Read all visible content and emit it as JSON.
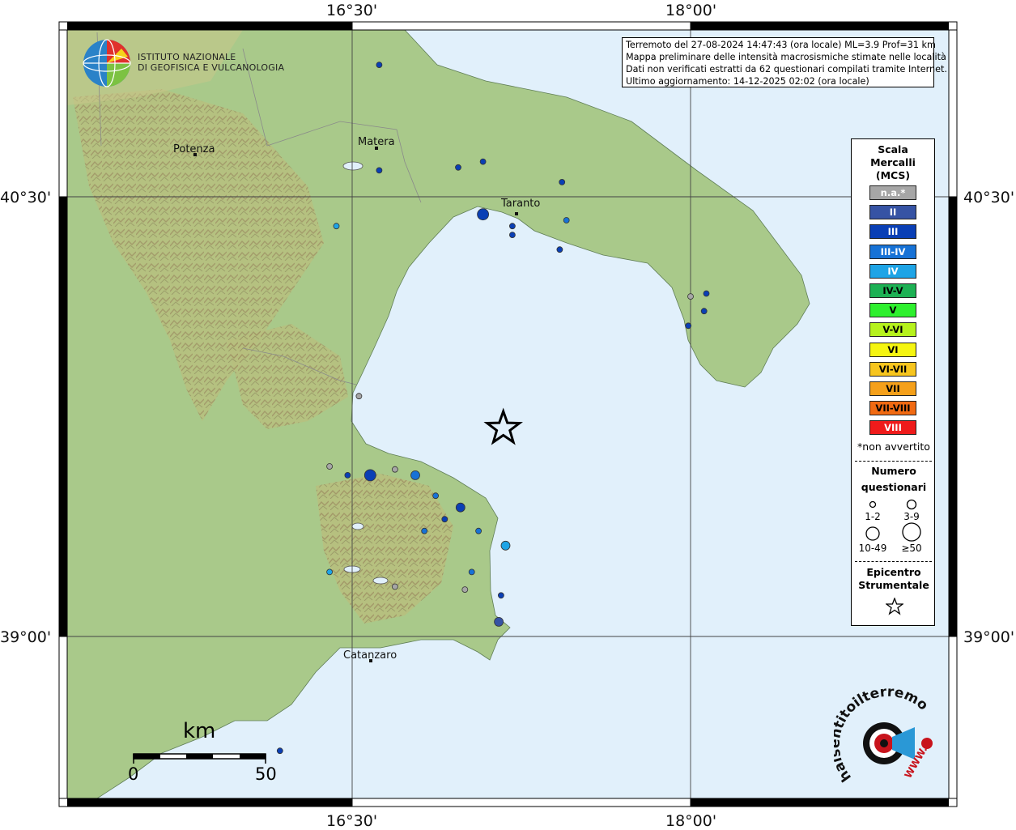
{
  "map_title": {
    "lines": [
      "Terremoto del 27-08-2024 14:47:43 (ora locale) ML=3.9 Prof=31 km",
      "Mappa preliminare delle intensità macrosismiche stimate nelle località",
      "Dati non verificati estratti da 62 questionari compilati tramite Internet.",
      "Ultimo aggiornamento: 14-12-2025 02:02 (ora locale)"
    ]
  },
  "institute": {
    "line1": "ISTITUTO NAZIONALE",
    "line2": "DI GEOFISICA E VULCANOLOGIA"
  },
  "grid_labels": {
    "lon_left": "16°30'",
    "lon_right": "18°00'",
    "lat_top": "40°30'",
    "lat_bottom": "39°00'"
  },
  "cities": {
    "potenza": "Potenza",
    "matera": "Matera",
    "taranto": "Taranto",
    "catanzaro": "Catanzaro"
  },
  "legend": {
    "title": [
      "Scala",
      "Mercalli",
      "(MCS)"
    ],
    "classes": [
      {
        "label": "n.a.*",
        "color": "#a6a6a6",
        "text_color": "#ffffff"
      },
      {
        "label": "II",
        "color": "#3653a4",
        "text_color": "#ffffff"
      },
      {
        "label": "III",
        "color": "#0a3fb5",
        "text_color": "#ffffff"
      },
      {
        "label": "III-IV",
        "color": "#1772d6",
        "text_color": "#ffffff"
      },
      {
        "label": "IV",
        "color": "#1ea4e6",
        "text_color": "#ffffff"
      },
      {
        "label": "IV-V",
        "color": "#1db154",
        "text_color": "#000000"
      },
      {
        "label": "V",
        "color": "#2ef02e",
        "text_color": "#000000"
      },
      {
        "label": "V-VI",
        "color": "#b6f21d",
        "text_color": "#000000"
      },
      {
        "label": "VI",
        "color": "#f5f511",
        "text_color": "#000000"
      },
      {
        "label": "VI-VII",
        "color": "#f7c51e",
        "text_color": "#000000"
      },
      {
        "label": "VII",
        "color": "#f5a01a",
        "text_color": "#000000"
      },
      {
        "label": "VII-VIII",
        "color": "#f16a12",
        "text_color": "#000000"
      },
      {
        "label": "VIII",
        "color": "#ef1b1b",
        "text_color": "#ffffff"
      }
    ],
    "note": "*non avvertito",
    "count_title_1": "Numero",
    "count_title_2": "questionari",
    "sizes": [
      "1-2",
      "3-9",
      "10-49",
      "≥50"
    ],
    "epicenter_title_1": "Epicentro",
    "epicenter_title_2": "Strumentale"
  },
  "scale_bar": {
    "unit": "km",
    "min": "0",
    "max": "50"
  },
  "brand": {
    "text": "haisentitoilterremoto.it",
    "www": "WWW.",
    "tld": ".it"
  },
  "observations": [
    {
      "lon": 16.62,
      "lat": 40.95,
      "intensity": "III",
      "size": "1-2"
    },
    {
      "lon": 16.62,
      "lat": 40.59,
      "intensity": "III",
      "size": "1-2"
    },
    {
      "lon": 16.97,
      "lat": 40.6,
      "intensity": "III",
      "size": "1-2"
    },
    {
      "lon": 17.08,
      "lat": 40.62,
      "intensity": "III",
      "size": "1-2"
    },
    {
      "lon": 17.43,
      "lat": 40.55,
      "intensity": "III",
      "size": "1-2"
    },
    {
      "lon": 17.08,
      "lat": 40.44,
      "intensity": "III",
      "size": "10-49"
    },
    {
      "lon": 17.45,
      "lat": 40.42,
      "intensity": "III-IV",
      "size": "1-2"
    },
    {
      "lon": 17.21,
      "lat": 40.4,
      "intensity": "III",
      "size": "1-2"
    },
    {
      "lon": 17.21,
      "lat": 40.37,
      "intensity": "III",
      "size": "1-2"
    },
    {
      "lon": 17.42,
      "lat": 40.32,
      "intensity": "III",
      "size": "1-2"
    },
    {
      "lon": 16.43,
      "lat": 40.4,
      "intensity": "IV",
      "size": "1-2"
    },
    {
      "lon": 18.07,
      "lat": 40.17,
      "intensity": "III",
      "size": "1-2"
    },
    {
      "lon": 18.0,
      "lat": 40.16,
      "intensity": "n.a.*",
      "size": "1-2"
    },
    {
      "lon": 18.06,
      "lat": 40.11,
      "intensity": "III",
      "size": "1-2"
    },
    {
      "lon": 17.99,
      "lat": 40.06,
      "intensity": "III",
      "size": "1-2"
    },
    {
      "lon": 16.53,
      "lat": 39.82,
      "intensity": "n.a.*",
      "size": "1-2"
    },
    {
      "lon": 16.4,
      "lat": 39.58,
      "intensity": "n.a.*",
      "size": "1-2"
    },
    {
      "lon": 16.48,
      "lat": 39.55,
      "intensity": "III",
      "size": "1-2"
    },
    {
      "lon": 16.58,
      "lat": 39.55,
      "intensity": "III",
      "size": "10-49"
    },
    {
      "lon": 16.69,
      "lat": 39.57,
      "intensity": "n.a.*",
      "size": "1-2"
    },
    {
      "lon": 16.78,
      "lat": 39.55,
      "intensity": "III-IV",
      "size": "3-9"
    },
    {
      "lon": 16.87,
      "lat": 39.48,
      "intensity": "III-IV",
      "size": "1-2"
    },
    {
      "lon": 16.98,
      "lat": 39.44,
      "intensity": "III",
      "size": "3-9"
    },
    {
      "lon": 16.91,
      "lat": 39.4,
      "intensity": "III",
      "size": "1-2"
    },
    {
      "lon": 16.82,
      "lat": 39.36,
      "intensity": "III-IV",
      "size": "1-2"
    },
    {
      "lon": 17.06,
      "lat": 39.36,
      "intensity": "III-IV",
      "size": "1-2"
    },
    {
      "lon": 17.18,
      "lat": 39.31,
      "intensity": "IV",
      "size": "3-9"
    },
    {
      "lon": 16.4,
      "lat": 39.22,
      "intensity": "IV",
      "size": "1-2"
    },
    {
      "lon": 17.03,
      "lat": 39.22,
      "intensity": "III-IV",
      "size": "1-2"
    },
    {
      "lon": 16.69,
      "lat": 39.17,
      "intensity": "n.a.*",
      "size": "1-2"
    },
    {
      "lon": 17.0,
      "lat": 39.16,
      "intensity": "n.a.*",
      "size": "1-2"
    },
    {
      "lon": 17.16,
      "lat": 39.14,
      "intensity": "III",
      "size": "1-2"
    },
    {
      "lon": 17.15,
      "lat": 39.05,
      "intensity": "II",
      "size": "3-9"
    },
    {
      "lon": 16.18,
      "lat": 38.61,
      "intensity": "III",
      "size": "1-2"
    }
  ],
  "epicenter": {
    "lon": 17.17,
    "lat": 39.71
  }
}
